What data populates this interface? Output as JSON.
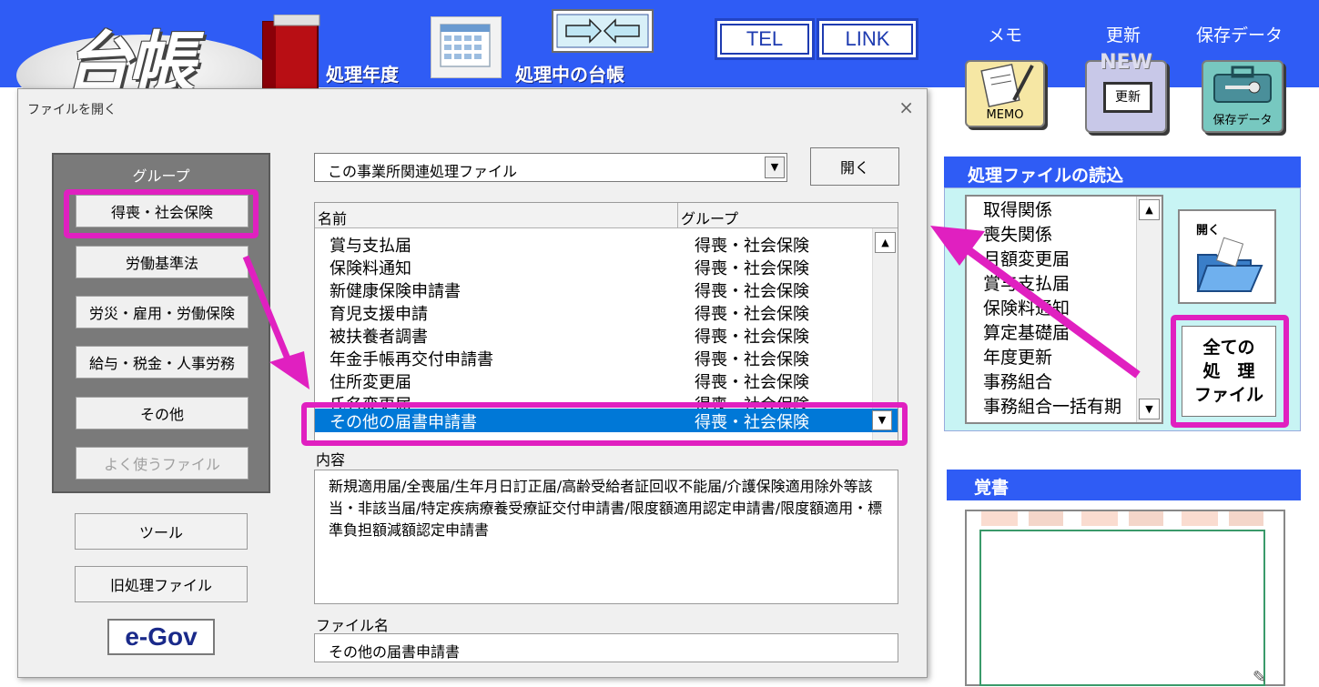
{
  "app": {
    "logo_text": "台帳",
    "processing_year_label": "処理年度",
    "current_ledger_label": "処理中の台帳",
    "tel_label": "TEL",
    "link_label": "LINK",
    "memo_label": "メモ",
    "memo_tile_caption": "MEMO",
    "update_label": "更新",
    "update_tile_badge": "NEW",
    "update_tile_caption": "更新",
    "save_label": "保存データ",
    "save_tile_caption": "保存データ"
  },
  "dialog": {
    "title": "ファイルを開く",
    "close": "×",
    "group_title": "グループ",
    "groups": [
      {
        "label": "得喪・社会保険"
      },
      {
        "label": "労働基準法"
      },
      {
        "label": "労災・雇用・労働保険"
      },
      {
        "label": "給与・税金・人事労務"
      },
      {
        "label": "その他"
      },
      {
        "label": "よく使うファイル"
      }
    ],
    "tools_button": "ツール",
    "old_files_button": "旧処理ファイル",
    "egov_label": "e-Gov",
    "combo_value": "この事業所関連処理ファイル",
    "open_button": "開く",
    "list_header": {
      "name": "名前",
      "group": "グループ"
    },
    "rows": [
      {
        "name": "賞与支払届",
        "group": "得喪・社会保険"
      },
      {
        "name": "保険料通知",
        "group": "得喪・社会保険"
      },
      {
        "name": "新健康保険申請書",
        "group": "得喪・社会保険"
      },
      {
        "name": "育児支援申請",
        "group": "得喪・社会保険"
      },
      {
        "name": "被扶養者調書",
        "group": "得喪・社会保険"
      },
      {
        "name": "年金手帳再交付申請書",
        "group": "得喪・社会保険"
      },
      {
        "name": "住所変更届",
        "group": "得喪・社会保険"
      },
      {
        "name": "氏名変更届",
        "group": "得喪・社会保険"
      }
    ],
    "selected_row": {
      "name": "その他の届書申請書",
      "group": "得喪・社会保険"
    },
    "content_label": "内容",
    "content_text": "新規適用届/全喪届/生年月日訂正届/高齢受給者証回収不能届/介護保険適用除外等該当・非該当届/特定疾病療養受療証交付申請書/限度額適用認定申請書/限度額適用・標準負担額減額認定申請書",
    "filename_label": "ファイル名",
    "filename_value": "その他の届書申請書"
  },
  "right_panel": {
    "read_header": "処理ファイルの読込",
    "files": [
      "取得関係",
      "喪失関係",
      "月額変更届",
      "賞与支払届",
      "保険料通知",
      "算定基礎届",
      "年度更新",
      "事務組合",
      "事務組合一括有期"
    ],
    "open_tile_label": "開く",
    "all_files_lines": [
      "全ての",
      "処　理",
      "ファイル"
    ],
    "memo_header": "覚書"
  },
  "colors": {
    "brand_blue": "#2f5cf5",
    "highlight_magenta": "#e020c0",
    "selection_blue": "#0078d7"
  }
}
